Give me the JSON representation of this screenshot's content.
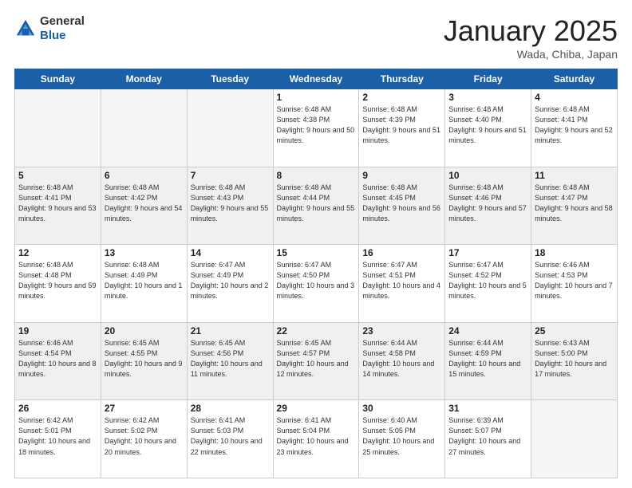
{
  "logo": {
    "general": "General",
    "blue": "Blue"
  },
  "title": "January 2025",
  "location": "Wada, Chiba, Japan",
  "days_of_week": [
    "Sunday",
    "Monday",
    "Tuesday",
    "Wednesday",
    "Thursday",
    "Friday",
    "Saturday"
  ],
  "weeks": [
    [
      {
        "num": "",
        "info": ""
      },
      {
        "num": "",
        "info": ""
      },
      {
        "num": "",
        "info": ""
      },
      {
        "num": "1",
        "info": "Sunrise: 6:48 AM\nSunset: 4:38 PM\nDaylight: 9 hours\nand 50 minutes."
      },
      {
        "num": "2",
        "info": "Sunrise: 6:48 AM\nSunset: 4:39 PM\nDaylight: 9 hours\nand 51 minutes."
      },
      {
        "num": "3",
        "info": "Sunrise: 6:48 AM\nSunset: 4:40 PM\nDaylight: 9 hours\nand 51 minutes."
      },
      {
        "num": "4",
        "info": "Sunrise: 6:48 AM\nSunset: 4:41 PM\nDaylight: 9 hours\nand 52 minutes."
      }
    ],
    [
      {
        "num": "5",
        "info": "Sunrise: 6:48 AM\nSunset: 4:41 PM\nDaylight: 9 hours\nand 53 minutes."
      },
      {
        "num": "6",
        "info": "Sunrise: 6:48 AM\nSunset: 4:42 PM\nDaylight: 9 hours\nand 54 minutes."
      },
      {
        "num": "7",
        "info": "Sunrise: 6:48 AM\nSunset: 4:43 PM\nDaylight: 9 hours\nand 55 minutes."
      },
      {
        "num": "8",
        "info": "Sunrise: 6:48 AM\nSunset: 4:44 PM\nDaylight: 9 hours\nand 55 minutes."
      },
      {
        "num": "9",
        "info": "Sunrise: 6:48 AM\nSunset: 4:45 PM\nDaylight: 9 hours\nand 56 minutes."
      },
      {
        "num": "10",
        "info": "Sunrise: 6:48 AM\nSunset: 4:46 PM\nDaylight: 9 hours\nand 57 minutes."
      },
      {
        "num": "11",
        "info": "Sunrise: 6:48 AM\nSunset: 4:47 PM\nDaylight: 9 hours\nand 58 minutes."
      }
    ],
    [
      {
        "num": "12",
        "info": "Sunrise: 6:48 AM\nSunset: 4:48 PM\nDaylight: 9 hours\nand 59 minutes."
      },
      {
        "num": "13",
        "info": "Sunrise: 6:48 AM\nSunset: 4:49 PM\nDaylight: 10 hours\nand 1 minute."
      },
      {
        "num": "14",
        "info": "Sunrise: 6:47 AM\nSunset: 4:49 PM\nDaylight: 10 hours\nand 2 minutes."
      },
      {
        "num": "15",
        "info": "Sunrise: 6:47 AM\nSunset: 4:50 PM\nDaylight: 10 hours\nand 3 minutes."
      },
      {
        "num": "16",
        "info": "Sunrise: 6:47 AM\nSunset: 4:51 PM\nDaylight: 10 hours\nand 4 minutes."
      },
      {
        "num": "17",
        "info": "Sunrise: 6:47 AM\nSunset: 4:52 PM\nDaylight: 10 hours\nand 5 minutes."
      },
      {
        "num": "18",
        "info": "Sunrise: 6:46 AM\nSunset: 4:53 PM\nDaylight: 10 hours\nand 7 minutes."
      }
    ],
    [
      {
        "num": "19",
        "info": "Sunrise: 6:46 AM\nSunset: 4:54 PM\nDaylight: 10 hours\nand 8 minutes."
      },
      {
        "num": "20",
        "info": "Sunrise: 6:45 AM\nSunset: 4:55 PM\nDaylight: 10 hours\nand 9 minutes."
      },
      {
        "num": "21",
        "info": "Sunrise: 6:45 AM\nSunset: 4:56 PM\nDaylight: 10 hours\nand 11 minutes."
      },
      {
        "num": "22",
        "info": "Sunrise: 6:45 AM\nSunset: 4:57 PM\nDaylight: 10 hours\nand 12 minutes."
      },
      {
        "num": "23",
        "info": "Sunrise: 6:44 AM\nSunset: 4:58 PM\nDaylight: 10 hours\nand 14 minutes."
      },
      {
        "num": "24",
        "info": "Sunrise: 6:44 AM\nSunset: 4:59 PM\nDaylight: 10 hours\nand 15 minutes."
      },
      {
        "num": "25",
        "info": "Sunrise: 6:43 AM\nSunset: 5:00 PM\nDaylight: 10 hours\nand 17 minutes."
      }
    ],
    [
      {
        "num": "26",
        "info": "Sunrise: 6:42 AM\nSunset: 5:01 PM\nDaylight: 10 hours\nand 18 minutes."
      },
      {
        "num": "27",
        "info": "Sunrise: 6:42 AM\nSunset: 5:02 PM\nDaylight: 10 hours\nand 20 minutes."
      },
      {
        "num": "28",
        "info": "Sunrise: 6:41 AM\nSunset: 5:03 PM\nDaylight: 10 hours\nand 22 minutes."
      },
      {
        "num": "29",
        "info": "Sunrise: 6:41 AM\nSunset: 5:04 PM\nDaylight: 10 hours\nand 23 minutes."
      },
      {
        "num": "30",
        "info": "Sunrise: 6:40 AM\nSunset: 5:05 PM\nDaylight: 10 hours\nand 25 minutes."
      },
      {
        "num": "31",
        "info": "Sunrise: 6:39 AM\nSunset: 5:07 PM\nDaylight: 10 hours\nand 27 minutes."
      },
      {
        "num": "",
        "info": ""
      }
    ]
  ]
}
